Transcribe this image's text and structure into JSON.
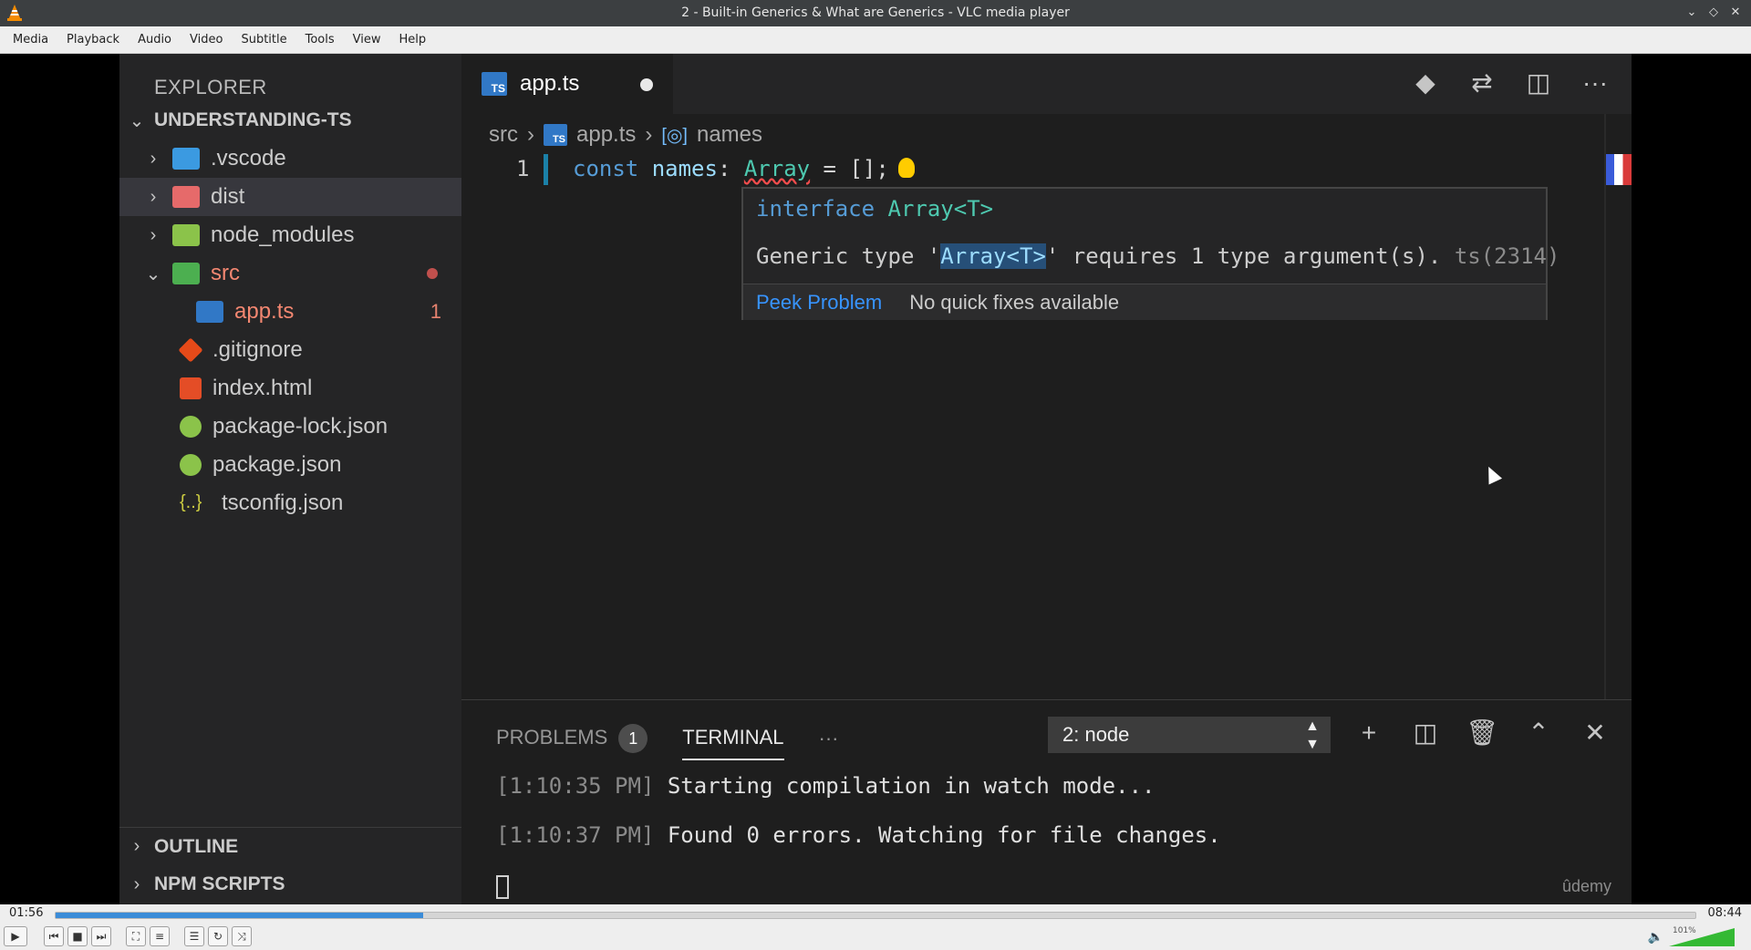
{
  "window": {
    "title": "2 - Built-in Generics & What are Generics - VLC media player",
    "controls": [
      "⌄",
      "◇",
      "✕"
    ]
  },
  "menu": [
    "Media",
    "Playback",
    "Audio",
    "Video",
    "Subtitle",
    "Tools",
    "View",
    "Help"
  ],
  "vscode": {
    "explorer_title": "EXPLORER",
    "project": "UNDERSTANDING-TS",
    "tree": [
      {
        "label": ".vscode",
        "chev": "›",
        "icon_color": "#3b9ae1"
      },
      {
        "label": "dist",
        "chev": "›",
        "icon_color": "#e66a6a"
      },
      {
        "label": "node_modules",
        "chev": "›",
        "icon_color": "#8bc34a"
      },
      {
        "label": "src",
        "chev": "⌄",
        "icon_color": "#4caf50"
      },
      {
        "label": "app.ts",
        "error_count": "1",
        "icon_color": "#3178c6"
      },
      {
        "label": ".gitignore",
        "icon_color": "#e64a19"
      },
      {
        "label": "index.html",
        "icon_color": "#e44d26"
      },
      {
        "label": "package-lock.json",
        "icon_color": "#8bc34a"
      },
      {
        "label": "package.json",
        "icon_color": "#8bc34a"
      },
      {
        "label": "tsconfig.json",
        "icon_color": "#cbcb41"
      }
    ],
    "outline": "OUTLINE",
    "npm_scripts": "NPM SCRIPTS",
    "tab": {
      "label": "app.ts",
      "badge": "TS"
    },
    "breadcrumb": {
      "src": "src",
      "file": "app.ts",
      "symbol": "names",
      "sep": "›"
    },
    "code": {
      "line_number": "1",
      "kw": "const",
      "name": "names",
      "colon": ": ",
      "type": "Array",
      "rest": " = [];"
    },
    "hover": {
      "sig_kw": "interface",
      "sig_type": "Array<T>",
      "msg_before": "Generic type '",
      "msg_highlight": "Array<T>",
      "msg_after": "' requires 1 type argument(s). ",
      "msg_code": "ts(2314)",
      "peek": "Peek Problem",
      "no_fixes": "No quick fixes available"
    },
    "panel": {
      "problems": "PROBLEMS",
      "problems_count": "1",
      "terminal": "TERMINAL",
      "more": "···",
      "terminal_select": "2: node",
      "lines": [
        {
          "ts": "[1:10:35 PM]",
          "text": " Starting compilation in watch mode..."
        },
        {
          "ts": "[1:10:37 PM]",
          "text": " Found 0 errors. Watching for file changes."
        }
      ]
    },
    "watermark": "ûdemy"
  },
  "player": {
    "elapsed": "01:56",
    "total": "08:44",
    "progress": 0.224,
    "volume_pct": "101%",
    "accent": "#3b8cd8"
  }
}
